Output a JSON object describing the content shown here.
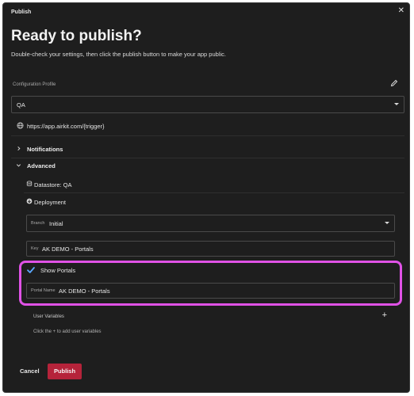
{
  "dialog": {
    "title": "Publish",
    "close_glyph": "✕",
    "heading": "Ready to publish?",
    "subtitle": "Double-check your settings, then click the publish button to make your app public."
  },
  "config": {
    "label": "Configuration Profile",
    "edit_icon": "pencil-icon",
    "selected": "QA"
  },
  "url": {
    "icon": "globe-icon",
    "text": "https://app.airkit.com/{trigger}"
  },
  "sections": {
    "notifications": {
      "label": "Notifications",
      "expanded": false
    },
    "advanced": {
      "label": "Advanced",
      "expanded": true
    }
  },
  "advanced": {
    "datastore": {
      "icon": "datastore-icon",
      "label": "Datastore: QA"
    },
    "deployment": {
      "icon": "deployment-icon",
      "label": "Deployment"
    },
    "branch": {
      "label": "Branch",
      "value": "Initial"
    },
    "key": {
      "label": "Key",
      "value": "AK DEMO - Portals"
    },
    "show_portals": {
      "label": "Show Portals",
      "checked": true
    },
    "portal_name": {
      "label": "Portal Name",
      "value": "AK DEMO - Portals"
    },
    "user_variables": {
      "label": "User Variables",
      "add_glyph": "+",
      "hint": "Click the + to add user variables"
    }
  },
  "footer": {
    "cancel": "Cancel",
    "publish": "Publish"
  },
  "colors": {
    "background": "#1e1e1e",
    "publish_button": "#b5233a",
    "highlight": "#e052e6",
    "checkbox": "#5aa9ff"
  }
}
